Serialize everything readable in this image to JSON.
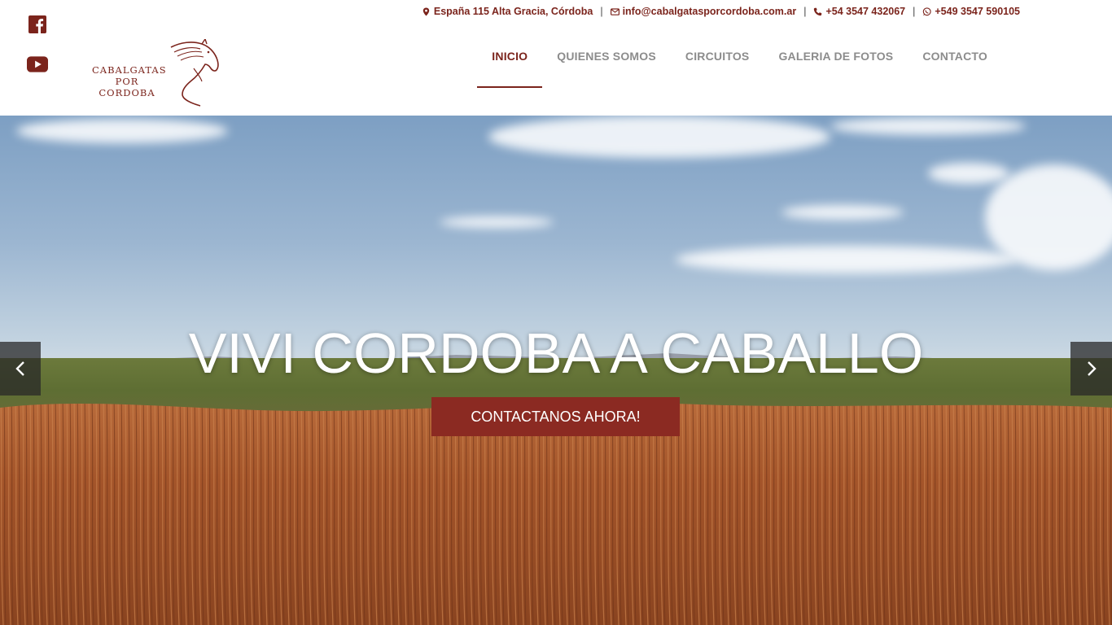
{
  "brand": {
    "logo_line1": "CABALGATAS",
    "logo_line2": "POR",
    "logo_line3": "CORDOBA",
    "accent_color": "#7b241c"
  },
  "social": [
    {
      "icon": "facebook-icon"
    },
    {
      "icon": "youtube-icon"
    }
  ],
  "contact": {
    "address": "España 115 Alta Gracia, Córdoba",
    "email": "info@cabalgatasporcordoba.com.ar",
    "phone": "+54 3547 432067",
    "whatsapp": "+549 3547 590105",
    "separator": "|"
  },
  "nav": [
    {
      "label": "INICIO",
      "active": true
    },
    {
      "label": "QUIENES SOMOS",
      "active": false
    },
    {
      "label": "CIRCUITOS",
      "active": false
    },
    {
      "label": "GALERIA DE FOTOS",
      "active": false
    },
    {
      "label": "CONTACTO",
      "active": false
    }
  ],
  "hero": {
    "title": "VIVI CORDOBA A CABALLO",
    "cta_label": "CONTACTANOS AHORA!",
    "cta_color": "#8b2a22",
    "prev_icon": "chevron-left-icon",
    "next_icon": "chevron-right-icon"
  }
}
